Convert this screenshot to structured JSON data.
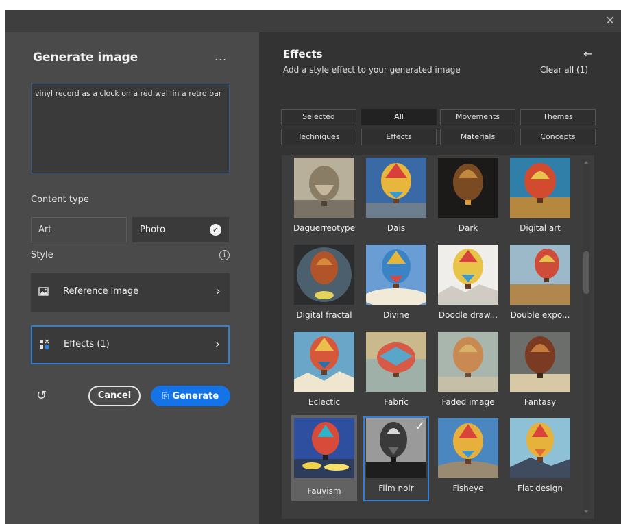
{
  "window": {
    "close_icon": "close-icon"
  },
  "left": {
    "title": "Generate image",
    "more_label": "...",
    "prompt_value": "vinyl record as a clock on a red wall in a retro bar",
    "content_type_label": "Content type",
    "content_types": {
      "art": "Art",
      "photo": "Photo"
    },
    "selected_content_type": "Photo",
    "style_label": "Style",
    "reference_image_label": "Reference image",
    "effects_label": "Effects (1)",
    "cancel_label": "Cancel",
    "generate_label": "Generate"
  },
  "right": {
    "title": "Effects",
    "subtitle": "Add a style effect to your generated image",
    "clear_all_label": "Clear all (1)",
    "tabs": [
      "Selected",
      "All",
      "Movements",
      "Themes",
      "Techniques",
      "Effects",
      "Materials",
      "Concepts"
    ],
    "active_tab": "All",
    "effects": [
      {
        "label": "Daguerreotype"
      },
      {
        "label": "Dais"
      },
      {
        "label": "Dark"
      },
      {
        "label": "Digital art"
      },
      {
        "label": "Digital fractal"
      },
      {
        "label": "Divine"
      },
      {
        "label": "Doodle draw..."
      },
      {
        "label": "Double expo..."
      },
      {
        "label": "Eclectic"
      },
      {
        "label": "Fabric"
      },
      {
        "label": "Faded image"
      },
      {
        "label": "Fantasy"
      },
      {
        "label": "Fauvism"
      },
      {
        "label": "Film noir"
      },
      {
        "label": "Fisheye"
      },
      {
        "label": "Flat design"
      }
    ],
    "selected_effect": "Film noir"
  },
  "colors": {
    "accent": "#1473e6",
    "selection": "#2f7fd6"
  }
}
